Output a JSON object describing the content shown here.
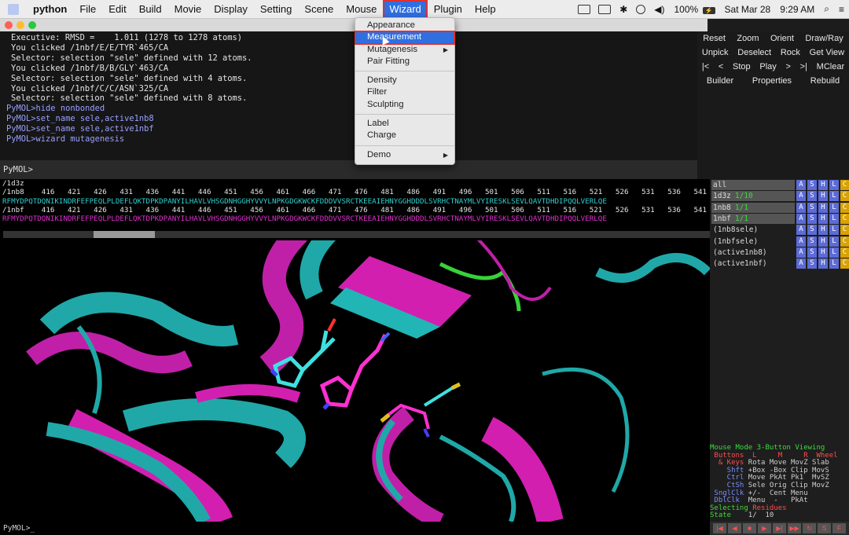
{
  "menubar": {
    "app_name": "python",
    "items": [
      "File",
      "Edit",
      "Build",
      "Movie",
      "Display",
      "Setting",
      "Scene",
      "Mouse",
      "Wizard",
      "Plugin",
      "Help"
    ],
    "active_item": "Wizard",
    "battery": "100%",
    "battery_badge": "⚡",
    "date": "Sat Mar 28",
    "time": "9:29 AM"
  },
  "colors": {
    "menu_highlight": "#2f6fe0",
    "annotation_red": "#e03030",
    "chain_cyan": "#30d0d0",
    "chain_magenta": "#e030d0",
    "ligand_green": "#3bdc3b"
  },
  "console": {
    "lines": [
      {
        "kind": "out",
        "text": "Executive: RMSD =    1.011 (1278 to 1278 atoms)"
      },
      {
        "kind": "out",
        "text": "You clicked /1nbf/E/E/TYR`465/CA"
      },
      {
        "kind": "out",
        "text": "Selector: selection \"sele\" defined with 12 atoms."
      },
      {
        "kind": "out",
        "text": "You clicked /1nbf/B/B/GLY`463/CA"
      },
      {
        "kind": "out",
        "text": "Selector: selection \"sele\" defined with 4 atoms."
      },
      {
        "kind": "out",
        "text": "You clicked /1nbf/C/C/ASN`325/CA"
      },
      {
        "kind": "out",
        "text": "Selector: selection \"sele\" defined with 8 atoms."
      },
      {
        "kind": "cmd",
        "text": "PyMOL>hide nonbonded"
      },
      {
        "kind": "cmd",
        "text": "PyMOL>set_name sele,active1nb8"
      },
      {
        "kind": "cmd",
        "text": "PyMOL>set_name sele,active1nbf"
      },
      {
        "kind": "cmd",
        "text": "PyMOL>wizard mutagenesis"
      }
    ],
    "prompt": "PyMOL>"
  },
  "button_panel": {
    "rows": [
      [
        "Reset",
        "Zoom",
        "Orient",
        "Draw/Ray"
      ],
      [
        "Unpick",
        "Deselect",
        "Rock",
        "Get View"
      ],
      [
        "|<",
        "<",
        "Stop",
        "Play",
        ">",
        ">|",
        "MClear"
      ],
      [
        "Builder",
        "Properties",
        "Rebuild"
      ]
    ]
  },
  "wizard_menu": {
    "groups": [
      [
        {
          "label": "Appearance"
        },
        {
          "label": "Measurement",
          "highlight": true
        },
        {
          "label": "Mutagenesis",
          "submenu": true
        },
        {
          "label": "Pair Fitting"
        }
      ],
      [
        {
          "label": "Density"
        },
        {
          "label": "Filter"
        },
        {
          "label": "Sculpting"
        }
      ],
      [
        {
          "label": "Label"
        },
        {
          "label": "Charge"
        }
      ],
      [
        {
          "label": "Demo",
          "submenu": true
        }
      ]
    ]
  },
  "sequence": {
    "header": "/1d3z",
    "rows": [
      {
        "kind": "hdr",
        "text": "/1nb8    416   421   426   431   436   441   446   451   456   461   466   471   476   481   486   491   496   501   506   511   516   521   526   531   536   541"
      },
      {
        "kind": "s8",
        "text": "RFMYDPQTDQNIKINDRFEFPEQLPLDEFLQKTDPKDPANYILHAVLVHSGDNHGGHYVVYLNPKGDGKWCKFDDDVVSRCTKEEAIEHNYGGHDDDLSVRHCTNAYMLVYIRESKLSEVLQAVTDHDIPQQLVERLQE"
      },
      {
        "kind": "hdr",
        "text": "/1nbf    416   421   426   431   436   441   446   451   456   461   466   471   476   481   486   491   496   501   506   511   516   521   526   531   536   541"
      },
      {
        "kind": "sf",
        "text": "RFMYDPQTDQNIKINDRFEFPEQLPLDEFLQKTDPKDPANYILHAVLVHSGDNHGGHYVVYLNPKGDGKWCKFDDDVVSRCTKEEAIEHNYGGHDDDLSVRHCTNAYMLVYIRESKLSEVLQAVTDHDIPQQLVERLQE"
      }
    ]
  },
  "objects": [
    {
      "name": "all",
      "tag": "",
      "enabled": true
    },
    {
      "name": "1d3z",
      "tag": "1/10",
      "enabled": true
    },
    {
      "name": "1nb8",
      "tag": "1/1",
      "enabled": true
    },
    {
      "name": "1nbf",
      "tag": "1/1",
      "enabled": true
    },
    {
      "name": "(1nb8sele)",
      "tag": "",
      "enabled": false
    },
    {
      "name": "(1nbfsele)",
      "tag": "",
      "enabled": false
    },
    {
      "name": "(active1nb8)",
      "tag": "",
      "enabled": false
    },
    {
      "name": "(active1nbf)",
      "tag": "",
      "enabled": false
    }
  ],
  "object_buttons": [
    "A",
    "S",
    "H",
    "L",
    "C"
  ],
  "mouse_mode": {
    "lines": [
      [
        {
          "c": "green",
          "t": "Mouse Mode 3-Button Viewing"
        }
      ],
      [
        {
          "c": "red",
          "t": " Buttons  L     M     R  Wheel"
        }
      ],
      [
        {
          "c": "red",
          "t": "  & Keys "
        },
        {
          "c": "white",
          "t": "Rota Move MovZ Slab"
        }
      ],
      [
        {
          "c": "blue",
          "t": "    Shft "
        },
        {
          "c": "white",
          "t": "+Box -Box Clip MovS"
        }
      ],
      [
        {
          "c": "blue",
          "t": "    Ctrl "
        },
        {
          "c": "white",
          "t": "Move PkAt Pk1  MvSZ"
        }
      ],
      [
        {
          "c": "blue",
          "t": "    CtSh "
        },
        {
          "c": "white",
          "t": "Sele Orig Clip MovZ"
        }
      ],
      [
        {
          "c": "blue",
          "t": " SnglClk "
        },
        {
          "c": "white",
          "t": "+/-  Cent Menu"
        }
      ],
      [
        {
          "c": "blue",
          "t": " DblClk  "
        },
        {
          "c": "white",
          "t": "Menu  -   PkAt"
        }
      ],
      [
        {
          "c": "green",
          "t": "Selecting "
        },
        {
          "c": "red",
          "t": "Residues"
        }
      ],
      [
        {
          "c": "green",
          "t": "State "
        },
        {
          "c": "white",
          "t": "   1/  10"
        }
      ]
    ]
  },
  "movie_controls": [
    "|◀",
    "◀",
    "■",
    "▶",
    "▶|",
    "▶▶",
    "↻",
    "S",
    "F"
  ],
  "bottom_prompt": "PyMOL>_"
}
